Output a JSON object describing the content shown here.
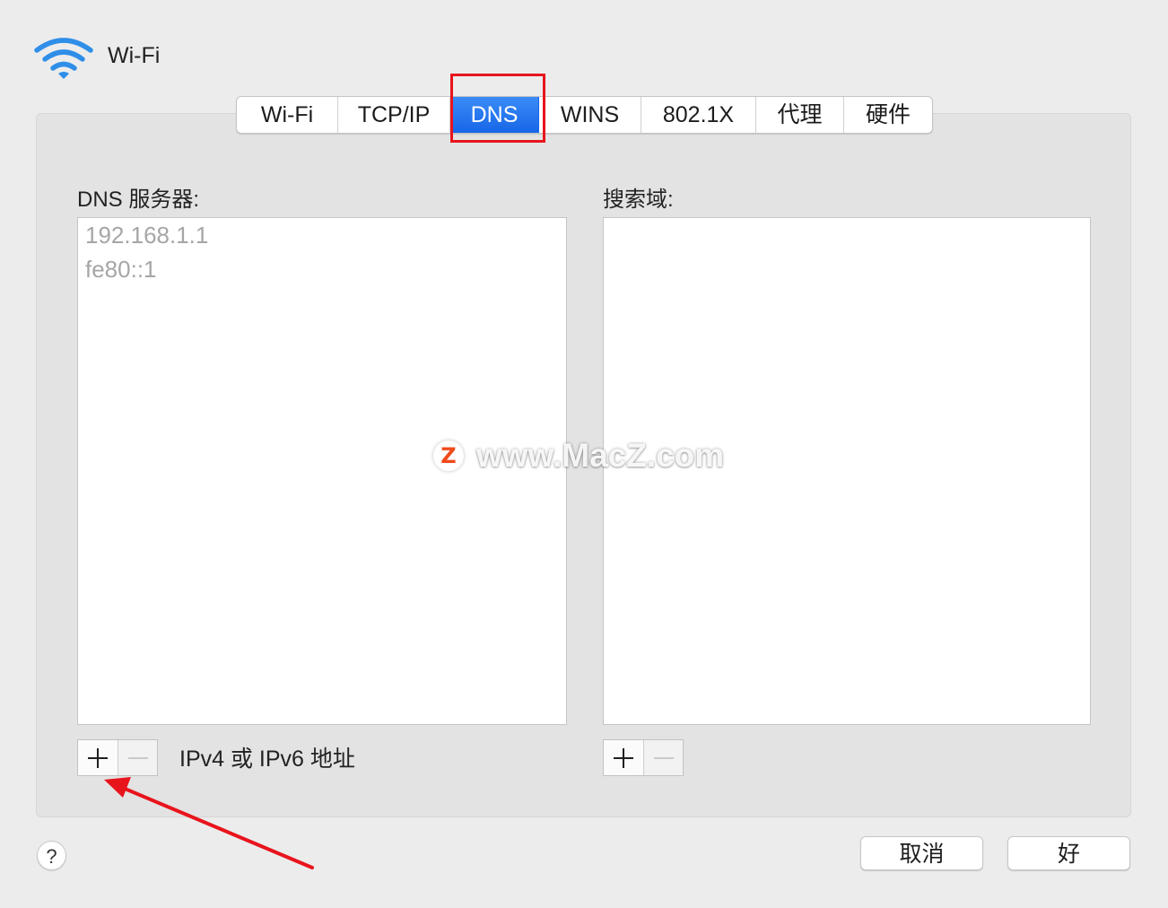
{
  "window": {
    "title": "Wi-Fi",
    "icon": "wifi-icon"
  },
  "tabs": [
    {
      "label": "Wi-Fi",
      "active": false
    },
    {
      "label": "TCP/IP",
      "active": false
    },
    {
      "label": "DNS",
      "active": true
    },
    {
      "label": "WINS",
      "active": false
    },
    {
      "label": "802.1X",
      "active": false
    },
    {
      "label": "代理",
      "active": false
    },
    {
      "label": "硬件",
      "active": false
    }
  ],
  "dns_servers": {
    "label": "DNS 服务器:",
    "items": [
      "192.168.1.1",
      "fe80::1"
    ],
    "hint": "IPv4 或 IPv6 地址"
  },
  "search_domains": {
    "label": "搜索域:",
    "items": []
  },
  "footer": {
    "help_label": "?",
    "cancel_label": "取消",
    "ok_label": "好"
  },
  "watermark": {
    "logo": "Z",
    "text": "www.MacZ.com"
  },
  "annotation_color": "#e8141c",
  "active_tab_color": "#1766e8"
}
